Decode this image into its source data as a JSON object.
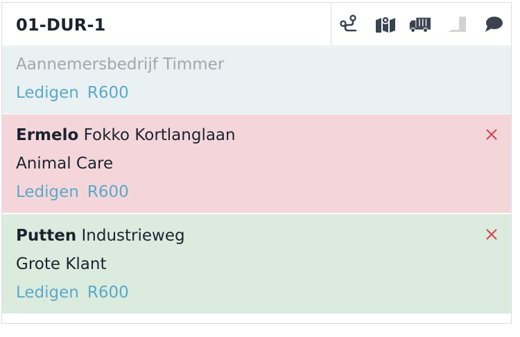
{
  "header": {
    "route_code": "01-DUR-1",
    "icons": [
      "route-icon",
      "map-icon",
      "truck-icon",
      "container-icon",
      "chat-icon"
    ]
  },
  "rows": [
    {
      "company": "Aannemersbedrijf Timmer",
      "action": "Ledigen",
      "code": "R600"
    },
    {
      "city": "Ermelo",
      "street": "Fokko Kortlanglaan",
      "company": "Animal Care",
      "action": "Ledigen",
      "code": "R600",
      "status_color": "#f4d6da"
    },
    {
      "city": "Putten",
      "street": "Industrieweg",
      "company": "Grote Klant",
      "action": "Ledigen",
      "code": "R600",
      "status_color": "#dbebde"
    }
  ],
  "colors": {
    "accent_link": "#5ba8c9",
    "close_red": "#d9464f",
    "icon_dark": "#3a4350",
    "icon_disabled": "#cfd3d6"
  }
}
